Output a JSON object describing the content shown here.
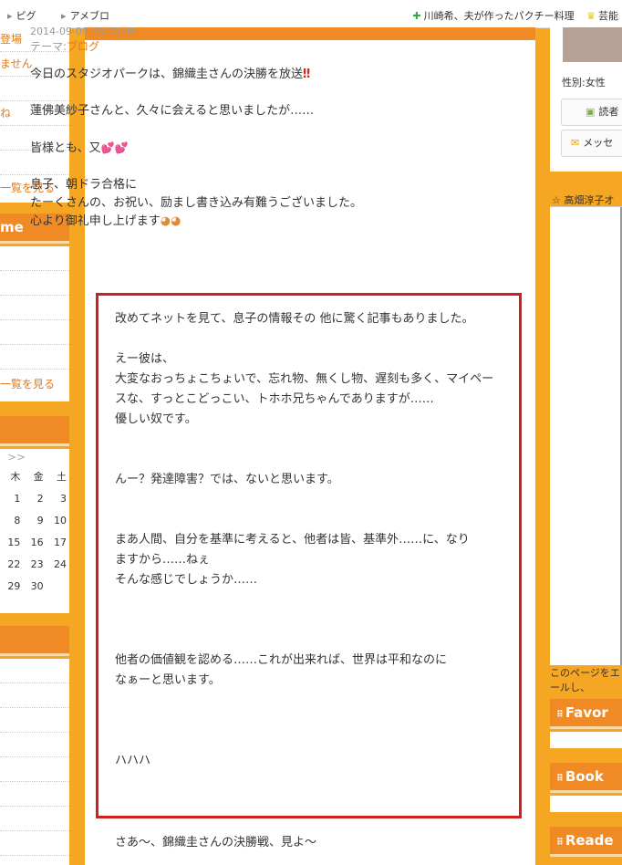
{
  "topbar": {
    "nav1": "ピグ",
    "nav2": "アメブロ",
    "link1": "川崎希、夫が作ったパクチー料理",
    "link2": "芸能"
  },
  "left": {
    "box1_rows": [
      "登場",
      "ません",
      "",
      "ね",
      "",
      ""
    ],
    "box1_more": "一覧を見る",
    "head2": "me",
    "box2_more": "一覧を見る",
    "head3": "",
    "cal_nav": ">>",
    "cal_headers": [
      "木",
      "金",
      "土"
    ],
    "cal_rows": [
      [
        "1",
        "2",
        "3"
      ],
      [
        "8",
        "9",
        "10"
      ],
      [
        "15",
        "16",
        "17"
      ],
      [
        "22",
        "23",
        "24"
      ],
      [
        "29",
        "30",
        ""
      ]
    ],
    "head4": ""
  },
  "post": {
    "date": "2014-09-09 10:25:41",
    "theme_label": "テーマ:",
    "theme_link": "ブログ",
    "p1": "今日のスタジオパークは、錦織圭さんの決勝を放送",
    "p2": "蓮佛美紗子さんと、久々に会えると思いましたが……",
    "p3": "皆様とも、又",
    "p4a": "息子、朝ドラ合格に",
    "p4b": "たーくさんの、お祝い、励まし書き込み有難うございました。",
    "p4c": "心より御礼申し上げます",
    "h1": "改めてネットを見て、息子の情報その 他に驚く記事もありました。",
    "h2a": "えー彼は、",
    "h2b": "大変なおっちょこちょいで、忘れ物、無くし物、遅刻も多く、マイペー",
    "h2c": "スな、すっとこどっこい、トホホ兄ちゃんでありますが……",
    "h2d": "優しい奴です。",
    "h3": "んー？発達障害？では、ないと思います。",
    "h4a": "まあ人間、自分を基準に考えると、他者は皆、基準外……に、なり",
    "h4b": "ますから……ねぇ",
    "h4c": "そんな感じでしょうか……",
    "h5a": "他者の価値観を認める……これが出来れば、世界は平和なのに",
    "h5b": "なぁーと思います。",
    "h6": "ハハハ",
    "last": "さあ～、錦織圭さんの決勝戦、見よ～"
  },
  "right": {
    "gender": "性別:女性",
    "btn1": "読者",
    "btn2": "メッセ",
    "star_title": "☆ 高畑淳子オ",
    "note1": "このページをエ",
    "note2": "ールし、",
    "head1": "Favor",
    "head2": "Book",
    "head3": "Reade"
  }
}
